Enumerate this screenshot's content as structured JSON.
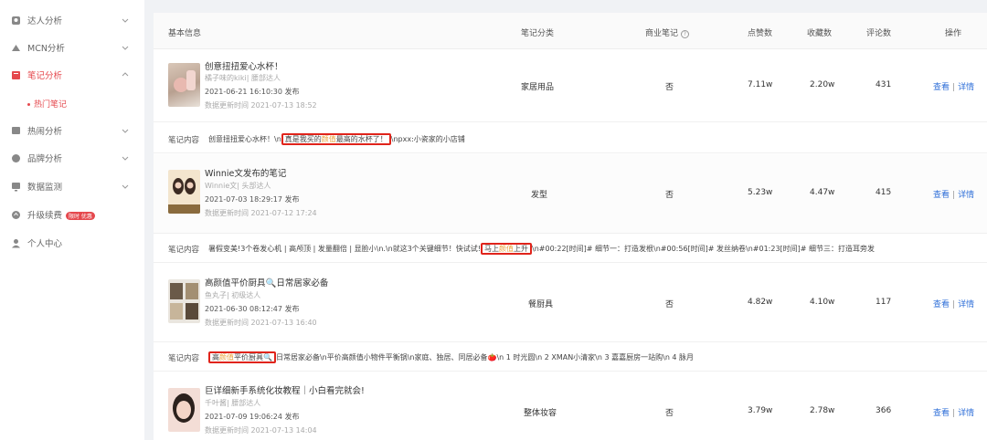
{
  "sidebar": {
    "items": [
      {
        "label": "达人分析",
        "icon": "users-icon"
      },
      {
        "label": "MCN分析",
        "icon": "mcn-icon"
      },
      {
        "label": "笔记分析",
        "icon": "notebook-icon"
      },
      {
        "label": "热闹分析",
        "icon": "hot-icon"
      },
      {
        "label": "品牌分析",
        "icon": "brand-icon"
      },
      {
        "label": "数据监测",
        "icon": "monitor-icon"
      },
      {
        "label": "升级续费",
        "icon": "upgrade-icon",
        "badge": "限时 优惠"
      },
      {
        "label": "个人中心",
        "icon": "person-icon"
      }
    ],
    "sub_item": "热门笔记"
  },
  "table": {
    "headers": {
      "basic": "基本信息",
      "category": "笔记分类",
      "commercial": "商业笔记",
      "likes": "点赞数",
      "favs": "收藏数",
      "comments": "评论数",
      "ops": "操作"
    },
    "content_label": "笔记内容",
    "op_view": "查看",
    "op_detail": "详情",
    "rows": [
      {
        "title": "创意扭扭爱心水杯！",
        "author": "橘子味的kiki| 腰部达人",
        "time": "2021-06-21 16:10:30 发布",
        "updated": "数据更新时间 2021-07-13 18:52",
        "category": "家居用品",
        "commercial": "否",
        "likes": "7.11w",
        "favs": "2.20w",
        "comments": "431",
        "content_pre": "创意扭扭爱心水杯！\\n",
        "content_box_a": "真是我买的",
        "content_hl": "颜值",
        "content_box_b": "最高的水杯了！",
        "content_post": "\\npxx:小瓷家的小店铺"
      },
      {
        "title": "Winnie文发布的笔记",
        "author": "Winnie文| 头部达人",
        "time": "2021-07-03 18:29:17 发布",
        "updated": "数据更新时间 2021-07-12 17:24",
        "category": "发型",
        "commercial": "否",
        "likes": "5.23w",
        "favs": "4.47w",
        "comments": "415",
        "content_pre": "暑假变美!3个卷发心机 | 高颅顶 | 发量翻倍 | 显脸小\\n.\\n就这3个关键细节！快试试!",
        "content_box_a": "马上",
        "content_hl": "颜值",
        "content_box_b": "上升",
        "content_post": "\\n#00:22[时间]# 细节一：打造发根\\n#00:56[时间]# 发丝纳卷\\n#01:23[时间]# 细节三：打造耳旁发"
      },
      {
        "title": "高颜值平价厨具🔍日常居家必备",
        "author": "鱼丸子| 初级达人",
        "time": "2021-06-30 08:12:47 发布",
        "updated": "数据更新时间 2021-07-13 16:40",
        "category": "餐厨具",
        "commercial": "否",
        "likes": "4.82w",
        "favs": "4.10w",
        "comments": "117",
        "content_box_a": "高",
        "content_hl": "颜值",
        "content_box_b": "平价厨具🔍",
        "content_post": "日常居家必备\\n平价高颜值小物件平衡锅\\n家庭、独居、同居必备🍅\\n 1 时光圆\\n 2 XMAN小清家\\n 3 嘉嘉厨房一站购\\n 4 脉月"
      },
      {
        "title": "巨详细新手系统化妆教程｜小白看完就会!",
        "author": "千叶酱| 腰部达人",
        "time": "2021-07-09 19:06:24 发布",
        "updated": "数据更新时间 2021-07-13 14:04",
        "category": "整体妆容",
        "commercial": "否",
        "likes": "3.79w",
        "favs": "2.78w",
        "comments": "366"
      }
    ]
  },
  "colors": {
    "accent": "#e5484d",
    "link": "#2f6fd8",
    "highlight": "#e8a33d",
    "box": "#e0241b"
  }
}
